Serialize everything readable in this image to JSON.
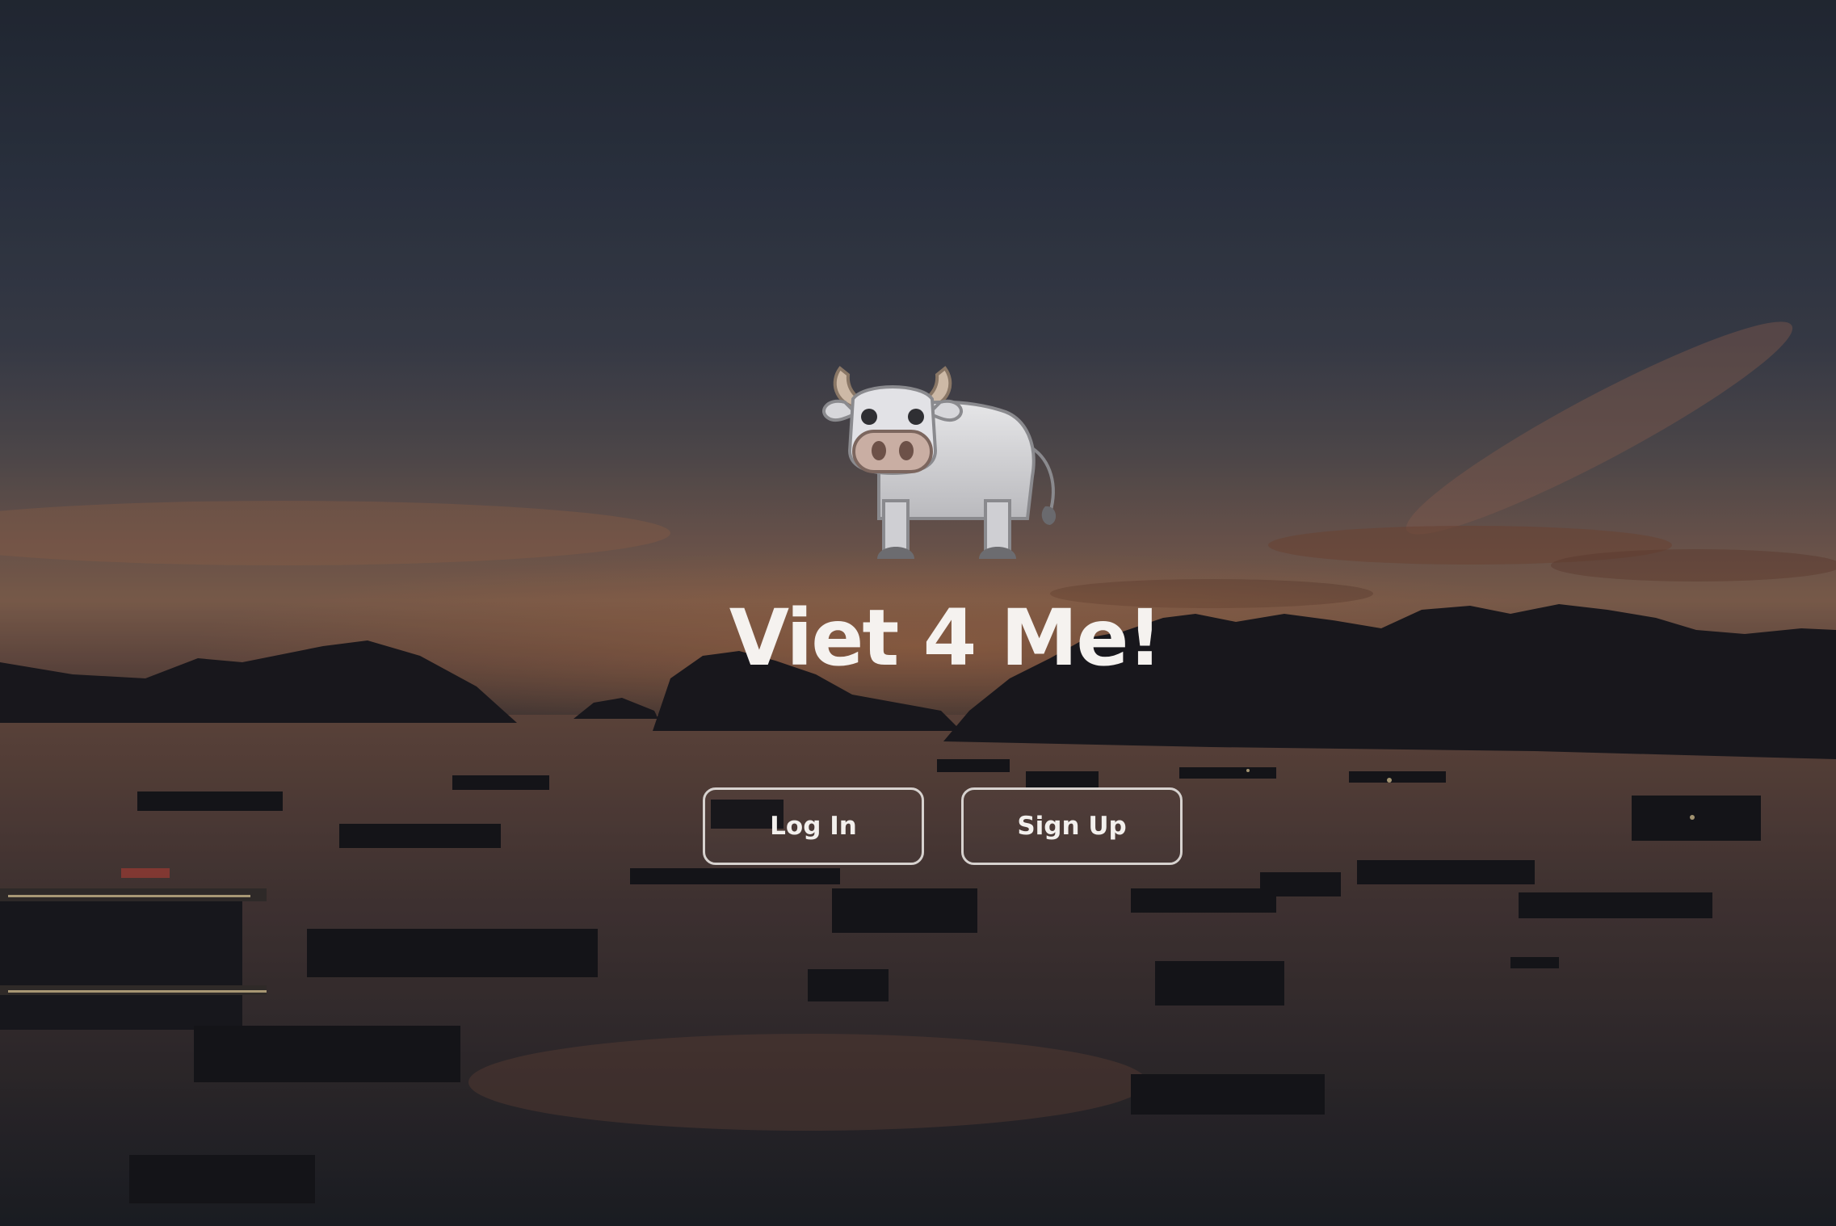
{
  "app": {
    "title": "Viet 4 Me!",
    "mascot_icon": "water-buffalo-icon"
  },
  "actions": {
    "login_label": "Log In",
    "signup_label": "Sign Up"
  },
  "colors": {
    "title": "#f5f2ef",
    "button_border": "#d7d2cf",
    "button_text": "#f3f0ed"
  }
}
